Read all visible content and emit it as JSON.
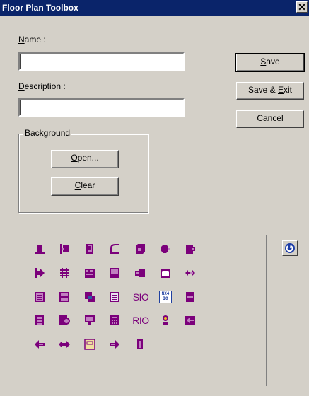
{
  "window": {
    "title": "Floor Plan Toolbox",
    "close_glyph": "✕"
  },
  "form": {
    "name_label_prefix": "",
    "name_label_hotkey": "N",
    "name_label_rest": "ame :",
    "name_value": "",
    "description_label_hotkey": "D",
    "description_label_rest": "escription :",
    "description_value": ""
  },
  "buttons": {
    "save_hotkey": "S",
    "save_rest": "ave",
    "save_exit_pre": "Save & ",
    "save_exit_hotkey": "E",
    "save_exit_rest": "xit",
    "cancel": "Cancel"
  },
  "background_group": {
    "title": "Background",
    "open_hotkey": "O",
    "open_rest": "pen...",
    "clear_hotkey": "C",
    "clear_rest": "lear"
  },
  "colors": {
    "accent": "#7b007b",
    "accent_light": "#c080c0",
    "titlebar": "#0a246a",
    "face": "#d4d0c8"
  },
  "tools": [
    [
      "dome-icon",
      "door-left-icon",
      "panel-icon",
      "corner-icon",
      "cube-icon",
      "octagon-camera-icon",
      "tag-icon"
    ],
    [
      "arrow-box-right-icon",
      "ladder-icon",
      "keypad-icon",
      "monitor-icon",
      "speaker-icon",
      "window-icon",
      "double-arrow-icon"
    ],
    [
      "list-box-icon",
      "list-box2-icon",
      "overlap-icon",
      "document-icon",
      "sio-text-icon",
      "nx4-io-icon",
      "small-panel-icon"
    ],
    [
      "server-icon",
      "gear-box-icon",
      "display-icon",
      "calculator-icon",
      "rio-text-icon",
      "person-icon",
      "arrow-left-box-icon"
    ],
    [
      "arrow-left-icon",
      "double-arrow-horizontal-icon",
      "framed-panel-icon",
      "arrow-right-icon",
      "tall-panel-icon"
    ]
  ],
  "tool_text": {
    "sio": "SIO",
    "rio": "RIO",
    "nx4_top": "NX4",
    "nx4_bottom": "IO"
  }
}
